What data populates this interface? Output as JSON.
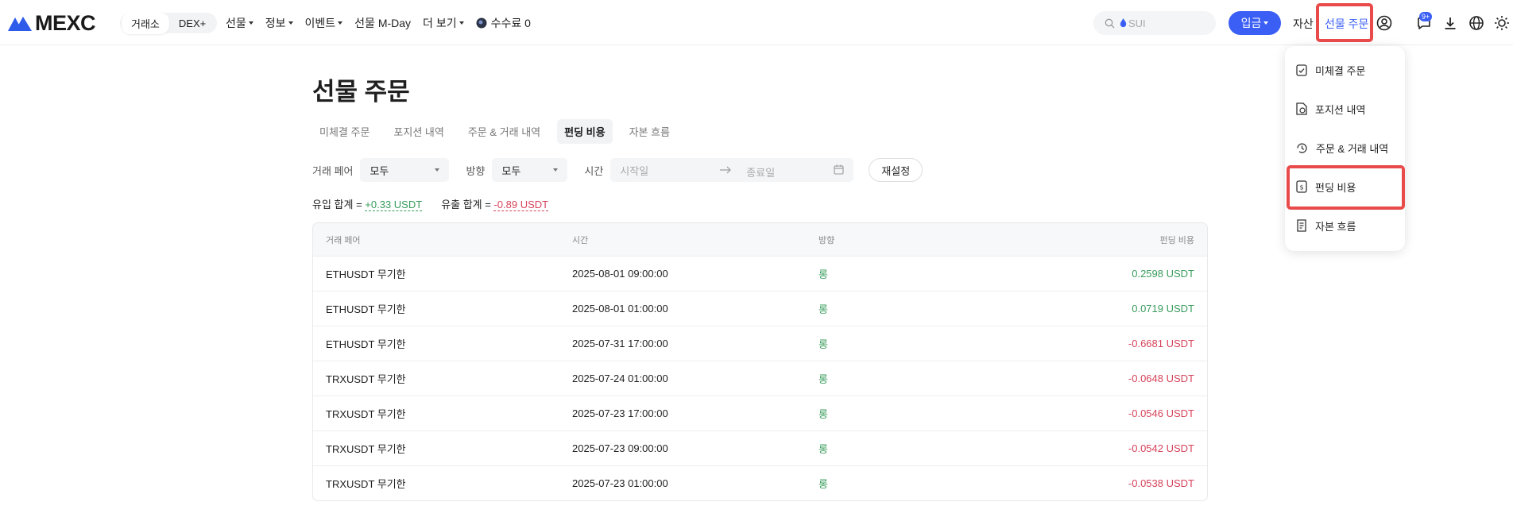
{
  "header": {
    "logo_text": "MEXC",
    "segments": [
      "거래소",
      "DEX+"
    ],
    "nav": [
      {
        "label": "선물",
        "caret": true
      },
      {
        "label": "정보",
        "caret": true
      },
      {
        "label": "이벤트",
        "caret": true
      },
      {
        "label": "선물 M-Day",
        "caret": false
      },
      {
        "label": "더 보기",
        "caret": true
      },
      {
        "label": "수수료 0",
        "caret": false
      }
    ],
    "search_placeholder": "SUI",
    "deposit_label": "입금",
    "assets_label": "자산",
    "futures_orders_label": "선물 주문",
    "notification_badge": "9+"
  },
  "dropdown": {
    "items": [
      "미체결 주문",
      "포지션 내역",
      "주문 & 거래 내역",
      "펀딩 비용",
      "자본 흐름"
    ]
  },
  "page": {
    "title": "선물 주문",
    "tabs": [
      "미체결 주문",
      "포지션 내역",
      "주문 & 거래 내역",
      "펀딩 비용",
      "자본 흐름"
    ],
    "active_tab": "펀딩 비용"
  },
  "filters": {
    "pair_label": "거래 페어",
    "pair_value": "모두",
    "direction_label": "방향",
    "direction_value": "모두",
    "time_label": "시간",
    "start_placeholder": "시작일",
    "end_placeholder": "종료일",
    "reset_label": "재설정"
  },
  "summary": {
    "inflow_label": "유입 합계 =",
    "inflow_value": "+0.33 USDT",
    "outflow_label": "유출 합계 =",
    "outflow_value": "-0.89 USDT"
  },
  "table": {
    "columns": [
      "거래 페어",
      "시간",
      "방향",
      "펀딩 비용"
    ],
    "rows": [
      {
        "pair": "ETHUSDT 무기한",
        "time": "2025-08-01 09:00:00",
        "direction": "롱",
        "fee": "0.2598 USDT",
        "sign": "pos"
      },
      {
        "pair": "ETHUSDT 무기한",
        "time": "2025-08-01 01:00:00",
        "direction": "롱",
        "fee": "0.0719 USDT",
        "sign": "pos"
      },
      {
        "pair": "ETHUSDT 무기한",
        "time": "2025-07-31 17:00:00",
        "direction": "롱",
        "fee": "-0.6681 USDT",
        "sign": "neg"
      },
      {
        "pair": "TRXUSDT 무기한",
        "time": "2025-07-24 01:00:00",
        "direction": "롱",
        "fee": "-0.0648 USDT",
        "sign": "neg"
      },
      {
        "pair": "TRXUSDT 무기한",
        "time": "2025-07-23 17:00:00",
        "direction": "롱",
        "fee": "-0.0546 USDT",
        "sign": "neg"
      },
      {
        "pair": "TRXUSDT 무기한",
        "time": "2025-07-23 09:00:00",
        "direction": "롱",
        "fee": "-0.0542 USDT",
        "sign": "neg"
      },
      {
        "pair": "TRXUSDT 무기한",
        "time": "2025-07-23 01:00:00",
        "direction": "롱",
        "fee": "-0.0538 USDT",
        "sign": "neg"
      }
    ]
  },
  "colors": {
    "accent": "#3b5ff5",
    "positive": "#3a9c5d",
    "negative": "#d6445b",
    "highlight": "#e94b4b"
  }
}
